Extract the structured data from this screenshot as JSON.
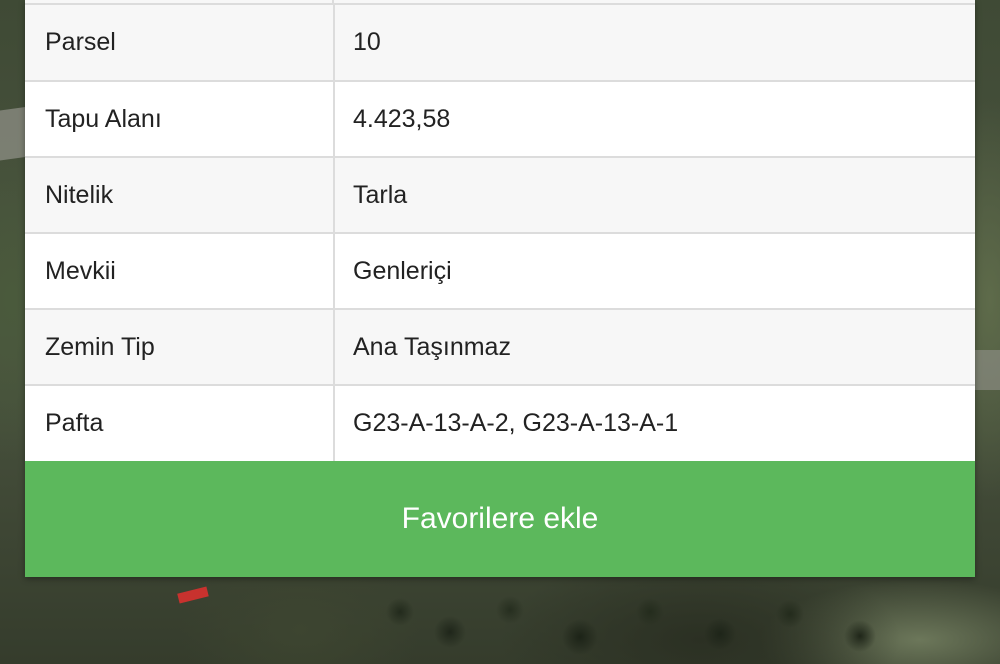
{
  "rows": [
    {
      "label": "Parsel",
      "value": "10"
    },
    {
      "label": "Tapu Alanı",
      "value": "4.423,58"
    },
    {
      "label": "Nitelik",
      "value": "Tarla"
    },
    {
      "label": "Mevkii",
      "value": "Genleriçi"
    },
    {
      "label": "Zemin Tip",
      "value": "Ana Taşınmaz"
    },
    {
      "label": "Pafta",
      "value": "G23-A-13-A-2, G23-A-13-A-1"
    }
  ],
  "favorite_button": {
    "label": "Favorilere ekle"
  },
  "colors": {
    "button_green": "#5cb85c",
    "row_alt": "#f7f7f7",
    "row": "#ffffff",
    "border": "#dcdcdc",
    "text": "#222222"
  }
}
